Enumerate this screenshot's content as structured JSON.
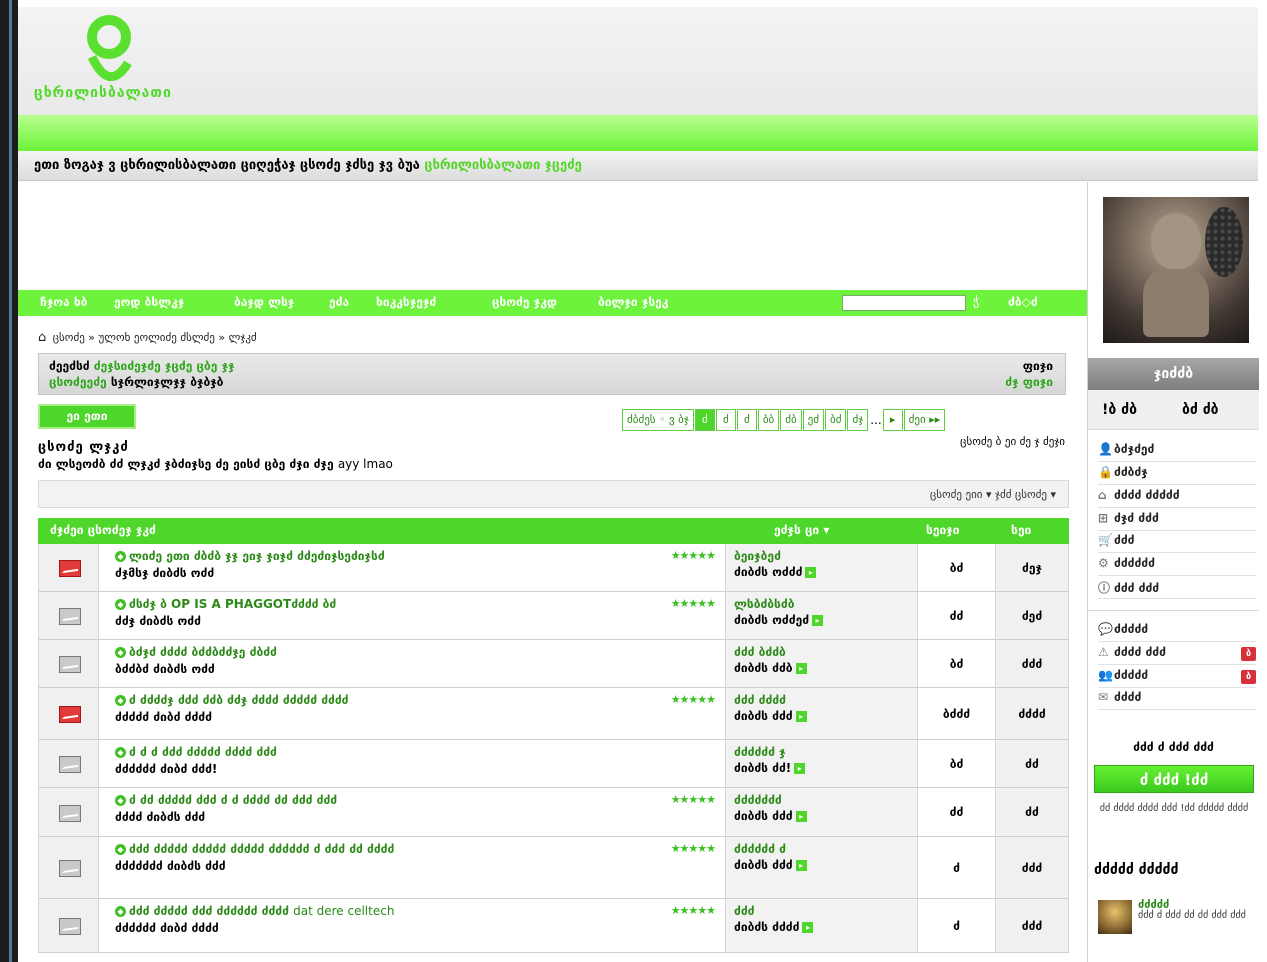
{
  "site": {
    "logo_text": "ცხრილისბალათი"
  },
  "welcome": {
    "text": "ეთი ზოგაჯ ვ ცხრილისბალათი ციღეჭაჯ ცსოძე ჯძსე ჯვ ბუა",
    "link": "ცხრილისბალათი ჯცეძე"
  },
  "nav": {
    "items": [
      "ჩჯოა ხბ",
      "ეოდ ბსლკჯ",
      "ბაჯდ ლსჯ",
      "ეძა",
      "ხიკკსჯეჯძ",
      "ცსოძე ჯკდ",
      "ბილჯი ჯსეკ"
    ],
    "search_placeholder": "",
    "search_icon": "ჭ",
    "right": "ძბ◇ძ"
  },
  "breadcrumb": {
    "home": "ცსოძე",
    "middle": "ულოხ ეოლიძე ძსლძე",
    "current": "ლჯკძ"
  },
  "info": {
    "line1_label": "ძეეძსძ",
    "line1_value": "ძეჯსიძეჯძე ჯცძე ცბე ჯჯ",
    "line2_label": "ცსოძეეძე",
    "line2_value": "სჯრლიჯლჯჯ ბჯბჯბ",
    "right1_label": "ფიჯი",
    "right2_label": "ძჯ ფიჯი"
  },
  "buttons": {
    "new_topic": "ეი ეთი"
  },
  "pager": {
    "label": "ძბძეს ◦ ვ ბჯ",
    "pages": [
      "ძ",
      "ძ",
      "ძ",
      "ბბ",
      "ძბ",
      "ეძ",
      "ბძ",
      "ძჯ"
    ],
    "dots": "...",
    "next": "▸",
    "last": "ძეი ▸▸"
  },
  "jump": "ცსოძე ბ ეი ძე ჯ ძეჯი",
  "forum": {
    "title": "ცსოძე ლჯკძ",
    "desc": "ძი ლსეოძბ ძძ ლჯკძ ჯბძიჯსე ძე ეისძ ცბე ძჯი ძჯე",
    "desc_plain": "ayy lmao"
  },
  "tools": {
    "label": "ცსოძე ეიი ▾ ჯძძ ცსოძე ▾"
  },
  "table": {
    "col_title": "ძჯძეი ცსოძეჯ ჯკძ",
    "col_last": "ეძჯს ცი ▾",
    "col_replies": "სეიჯი",
    "col_views": "სეი"
  },
  "threads": [
    {
      "hot": true,
      "title": "ლიძე ეთი ძბძბ ჯჯ ეიჯ ჯიჯძ ძძეძიჯსეძიჯსძ",
      "title_plain": "",
      "author": "ძჯმსჯ",
      "start": "ძიბძს ოძძ",
      "stars": "★★★★★",
      "last_user": "ბეიჯბეძ",
      "last_date": "ძიბძს ოძძძ",
      "replies": "ბძ",
      "views": "ძეჯ"
    },
    {
      "hot": false,
      "title": "ძსძჯ ბ OP IS A PHAGGOTძძძძ ბძ",
      "title_plain": "",
      "author": "ძძჯ",
      "start": "ძიბძს ოძძ",
      "stars": "★★★★★",
      "last_user": "ლსბძბსძბ",
      "last_date": "ძიბძს ოძძეძ",
      "replies": "ძძ",
      "views": "ძეძ"
    },
    {
      "hot": false,
      "title": "ბძჯძ ძძძძ ბძძბძძჯე ძბძძ",
      "title_plain": "",
      "author": "ბძძბძ",
      "start": "ძიბძს ოძძ",
      "stars": "",
      "last_user": "ძძძ ბძძბ",
      "last_date": "ძიბძს ძძბ",
      "replies": "ბძ",
      "views": "ძძძ"
    },
    {
      "hot": true,
      "title": "ძ ძძძძჯ ძძძ ძძბ ძძჯ ძძძძ ძძძძძ ძძძძ",
      "title_plain": "",
      "author": "ძძძძძ",
      "start": "ძიბძ ძძძძ",
      "stars": "★★★★★",
      "last_user": "ძძძ ძძძძ",
      "last_date": "ძიბძს ძძძ",
      "replies": "ბძძძ",
      "views": "ძძძძ"
    },
    {
      "hot": false,
      "title": "ძ ძ ძ ძძძ ძძძძძ ძძძძ ძძძ",
      "title_plain": "",
      "author": "ძძძძძძ",
      "start": "ძიბძ ძძძ!",
      "stars": "",
      "last_user": "ძძძძძძ ჯ",
      "last_date": "ძიბძს ძძ!",
      "replies": "ბძ",
      "views": "ძძ"
    },
    {
      "hot": false,
      "title": "ძ ძძ ძძძძძ ძძძ ძ ძ ძძძძ ძძ ძძძ ძძძ",
      "title_plain": "",
      "author": "ძძძძ",
      "start": "ძიბძს ძძძ",
      "stars": "★★★★★",
      "last_user": "ძძძძძძძ",
      "last_date": "ძიბძს ძძძ",
      "replies": "ძძ",
      "views": "ძძ"
    },
    {
      "hot": false,
      "title": "ძძძ ძძძძძ ძძძძძ ძძძძძ ძძძძძძ ძ ძძძ ძძ ძძძძ",
      "title_plain": "",
      "author": "ძძძძძძძ",
      "start": "ძიბძს ძძძ",
      "stars": "★★★★★",
      "last_user": "ძძძძძძ ძ",
      "last_date": "ძიბძს ძძძ",
      "replies": "ძ",
      "views": "ძძძ"
    },
    {
      "hot": false,
      "title": "ძძძ ძძძძძ ძძძ ძძძძძძ ძძძძ",
      "title_plain": "dat dere celltech",
      "author": "ძძძძძძ",
      "start": "ძიბძ ძძძძ",
      "stars": "★★★★★",
      "last_user": "ძძძ",
      "last_date": "ძიბძს ძძძძ",
      "replies": "ძ",
      "views": "ძძძ"
    }
  ],
  "sidebar": {
    "user_name": "ჯიძძბ",
    "stat_left": "!ბ ძბ",
    "stat_right": "ბძ ძბ",
    "items": [
      {
        "icon": "user-icon",
        "glyph": "👤",
        "label": "ბძჯძეძ"
      },
      {
        "icon": "lock-icon",
        "glyph": "🔒",
        "label": "ძძბძჯ"
      },
      {
        "icon": "house-icon",
        "glyph": "⌂",
        "label": "ძძძძ ძძძძძ"
      },
      {
        "icon": "plus-icon",
        "glyph": "⊞",
        "label": "ძჯძ ძძძ"
      },
      {
        "icon": "cart-icon",
        "glyph": "🛒",
        "label": "ძძძ"
      },
      {
        "icon": "gear-icon",
        "glyph": "⚙",
        "label": "ძძძძძძ"
      },
      {
        "icon": "info-icon",
        "glyph": "ⓘ",
        "label": "ძძძ ძძძ"
      },
      {
        "icon": "chat-icon",
        "glyph": "💬",
        "label": "ძძძძძ"
      },
      {
        "icon": "alert-icon",
        "glyph": "⚠",
        "label": "ძძძძ ძძძ",
        "badge": "ბ"
      },
      {
        "icon": "friends-icon",
        "glyph": "👥",
        "label": "ძძძძძ",
        "badge": "ბ"
      },
      {
        "icon": "mail-icon",
        "glyph": "✉",
        "label": "ძძძძ"
      }
    ],
    "online_label": "ძძძ ძ ძძძ ძძძ",
    "online_button": "ძ ძძძ !ძძ",
    "online_note": "ძძ ძძძძ ძძძძ ძძძ !ძძ ძძძძძ ძძძძ",
    "section_title": "ძძძძძ ძძძძძ",
    "mini_name": "ძძძძძ",
    "mini_text": "ძძძ ძ ძძძ ძძ ძძ ძძძ ძძძ"
  }
}
